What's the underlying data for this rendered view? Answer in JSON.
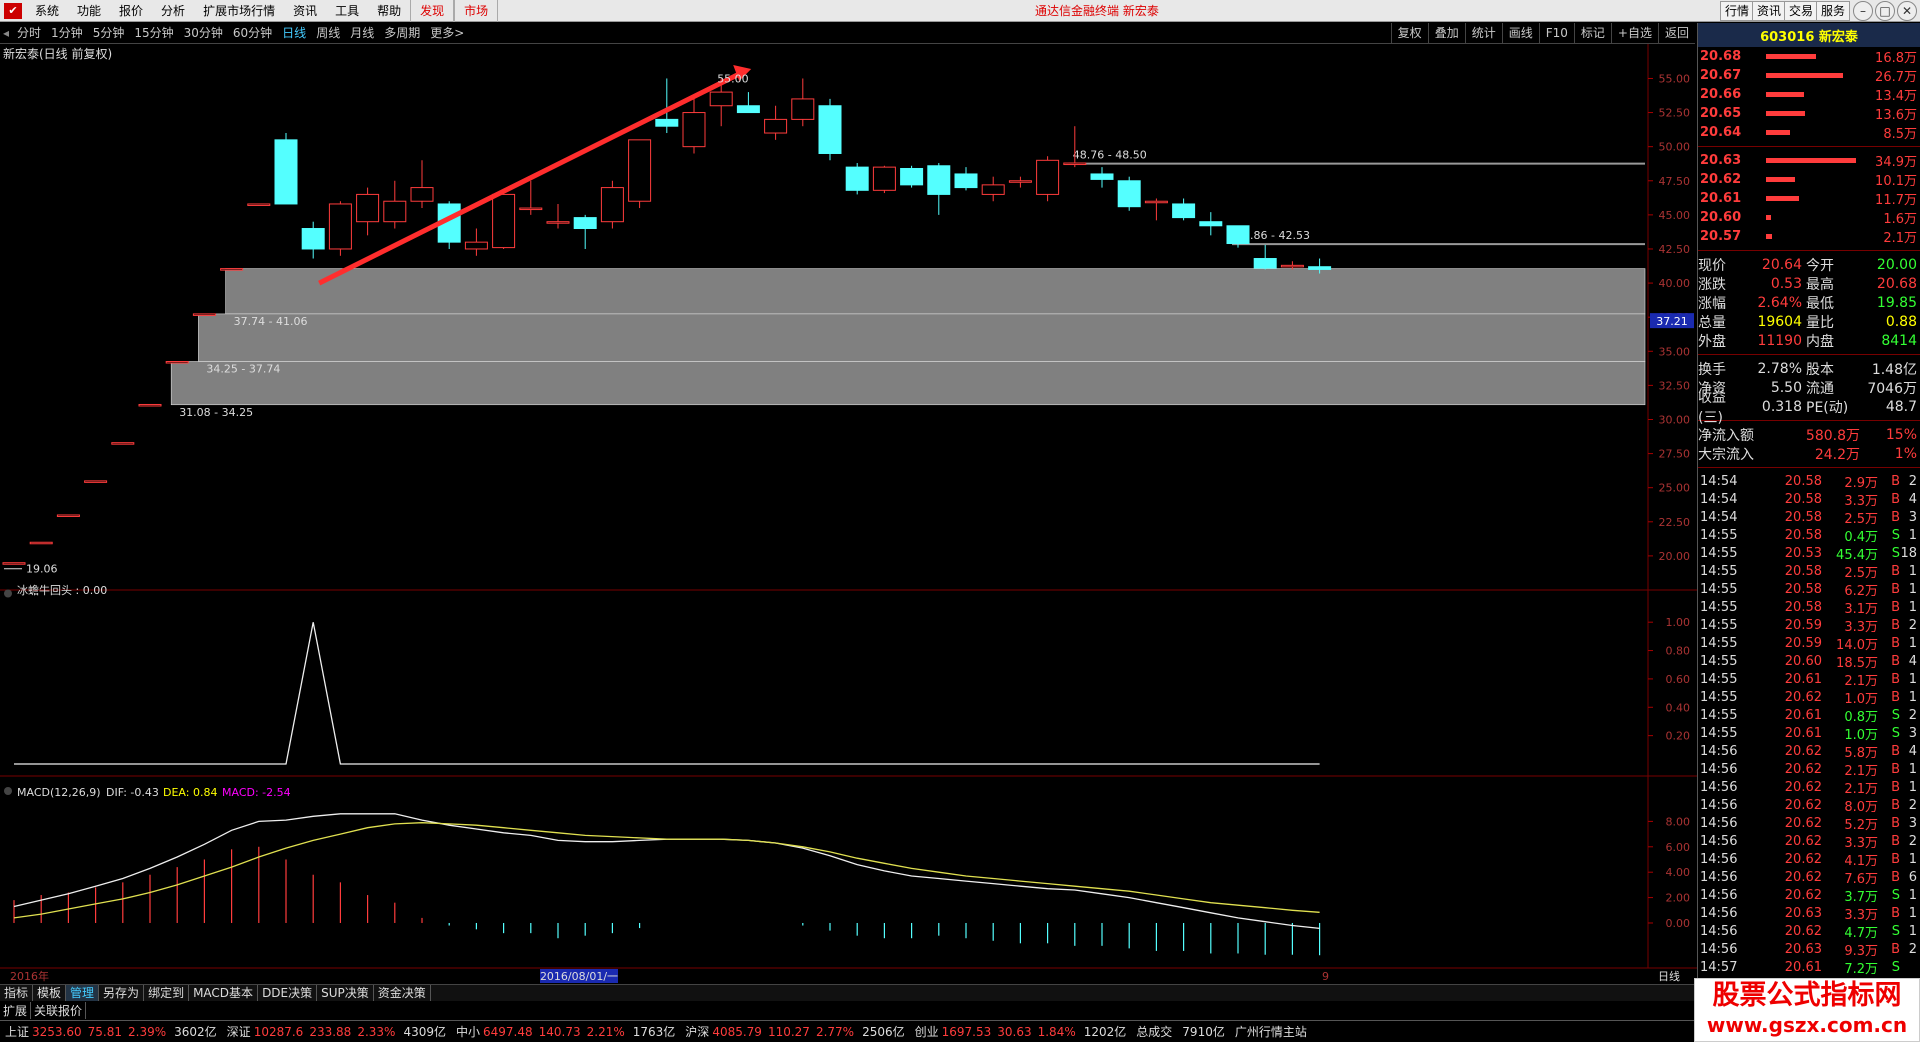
{
  "menubar": {
    "items": [
      "系统",
      "功能",
      "报价",
      "分析",
      "扩展市场行情",
      "资讯",
      "工具",
      "帮助"
    ],
    "highlight_items": [
      "发现",
      "市场"
    ],
    "title": "通达信金融终端  新宏泰",
    "right_buttons": [
      "行情",
      "资讯",
      "交易",
      "服务"
    ]
  },
  "periodbar": {
    "items": [
      "分时",
      "1分钟",
      "5分钟",
      "15分钟",
      "30分钟",
      "60分钟",
      "日线",
      "周线",
      "月线",
      "多周期",
      "更多>"
    ],
    "active": "日线",
    "tools": [
      "复权",
      "叠加",
      "统计",
      "画线",
      "F10",
      "标记",
      "+自选",
      "返回"
    ]
  },
  "main_chart": {
    "title": "新宏泰(日线 前复权)",
    "y_ticks": [
      "55.00",
      "52.50",
      "50.00",
      "47.50",
      "45.00",
      "42.50",
      "40.00",
      "37.50",
      "35.00",
      "32.50",
      "30.00",
      "27.50",
      "25.00",
      "22.50",
      "20.00"
    ],
    "current_price_tag": "37.21",
    "peak_label": "55.00",
    "low_label": "19.06",
    "zone_labels": [
      "48.76 - 48.50",
      "42.86 - 42.53",
      "37.74 - 41.06",
      "34.25 - 37.74",
      "31.08 - 34.25"
    ]
  },
  "chart_data": [
    {
      "type": "candlestick",
      "title": "新宏泰(日线 前复权)",
      "ylim": [
        17.5,
        56.5
      ],
      "y_ticks": [
        20,
        22.5,
        25,
        27.5,
        30,
        32.5,
        35,
        37.5,
        40,
        42.5,
        45,
        47.5,
        50,
        52.5,
        55
      ],
      "ohlc": [
        [
          19.5,
          19.5,
          19.5,
          19.5
        ],
        [
          21.0,
          21.0,
          21.0,
          21.0
        ],
        [
          23.0,
          23.0,
          23.0,
          23.0
        ],
        [
          25.5,
          25.5,
          25.5,
          25.5
        ],
        [
          28.3,
          28.3,
          28.3,
          28.3
        ],
        [
          31.1,
          31.1,
          31.1,
          31.1
        ],
        [
          34.25,
          34.25,
          34.25,
          34.25
        ],
        [
          37.74,
          37.74,
          37.74,
          37.74
        ],
        [
          41.06,
          41.06,
          41.06,
          41.06
        ],
        [
          45.8,
          45.8,
          45.8,
          45.8
        ],
        [
          50.5,
          51.0,
          45.8,
          45.8
        ],
        [
          44.0,
          44.5,
          41.8,
          42.5
        ],
        [
          42.5,
          46.0,
          42.0,
          45.8
        ],
        [
          44.5,
          47.0,
          43.5,
          46.5
        ],
        [
          44.5,
          47.5,
          44.0,
          46.0
        ],
        [
          46.0,
          49.0,
          45.5,
          47.0
        ],
        [
          45.8,
          46.0,
          42.5,
          43.0
        ],
        [
          42.5,
          44.0,
          42.0,
          43.0
        ],
        [
          42.6,
          46.8,
          42.5,
          46.5
        ],
        [
          45.5,
          47.5,
          45.0,
          45.5
        ],
        [
          44.5,
          45.8,
          44.0,
          44.5
        ],
        [
          44.8,
          45.0,
          42.5,
          44.0
        ],
        [
          44.5,
          47.5,
          44.0,
          47.0
        ],
        [
          46.0,
          50.5,
          45.5,
          50.5
        ],
        [
          52.0,
          55.0,
          51.0,
          51.5
        ],
        [
          50.0,
          53.5,
          49.5,
          52.5
        ],
        [
          53.0,
          55.0,
          51.5,
          54.0
        ],
        [
          53.0,
          54.0,
          52.5,
          52.5
        ],
        [
          51.0,
          53.0,
          50.5,
          52.0
        ],
        [
          52.0,
          55.0,
          51.5,
          53.5
        ],
        [
          53.0,
          53.5,
          49.0,
          49.5
        ],
        [
          48.5,
          48.8,
          46.5,
          46.8
        ],
        [
          46.8,
          48.6,
          46.6,
          48.5
        ],
        [
          48.4,
          48.6,
          47.0,
          47.2
        ],
        [
          48.6,
          48.8,
          45.0,
          46.5
        ],
        [
          48.0,
          48.5,
          46.8,
          47.0
        ],
        [
          46.5,
          47.8,
          46.0,
          47.2
        ],
        [
          47.4,
          47.8,
          47.0,
          47.5
        ],
        [
          46.5,
          49.3,
          46.0,
          49.0
        ],
        [
          48.7,
          51.5,
          48.5,
          48.8
        ],
        [
          48.0,
          48.5,
          47.0,
          47.6
        ],
        [
          47.5,
          47.8,
          45.3,
          45.6
        ],
        [
          46.0,
          46.2,
          44.6,
          46.0
        ],
        [
          45.8,
          46.2,
          44.6,
          44.8
        ],
        [
          44.5,
          45.2,
          43.5,
          44.2
        ],
        [
          44.2,
          44.2,
          42.6,
          42.9
        ],
        [
          41.8,
          42.8,
          41.0,
          41.1
        ],
        [
          41.2,
          41.6,
          41.0,
          41.3
        ],
        [
          41.2,
          41.8,
          40.7,
          41.0
        ]
      ],
      "zones": [
        {
          "label": "48.76 - 48.50",
          "low": 48.5,
          "high": 48.76
        },
        {
          "label": "42.86 - 42.53",
          "low": 42.53,
          "high": 42.86
        },
        {
          "label": "37.74 - 41.06",
          "low": 37.74,
          "high": 41.06
        },
        {
          "label": "34.25 - 37.74",
          "low": 34.25,
          "high": 37.74
        },
        {
          "label": "31.08 - 34.25",
          "low": 31.08,
          "high": 34.25
        }
      ]
    },
    {
      "type": "line",
      "title": "冰蟾牛回头 : 0.00",
      "ylim": [
        0,
        1.1
      ],
      "y_ticks": [
        0.2,
        0.4,
        0.6,
        0.8,
        1.0
      ],
      "series": [
        {
          "name": "冰蟾牛回头",
          "values": [
            0,
            0,
            0,
            0,
            0,
            0,
            0,
            0,
            0,
            0,
            0,
            1,
            0,
            0,
            0,
            0,
            0,
            0,
            0,
            0,
            0,
            0,
            0,
            0,
            0,
            0,
            0,
            0,
            0,
            0,
            0,
            0,
            0,
            0,
            0,
            0,
            0,
            0,
            0,
            0,
            0,
            0,
            0,
            0,
            0,
            0,
            0,
            0,
            0
          ]
        }
      ]
    },
    {
      "type": "line",
      "title": "MACD(12,26,9)",
      "ylim": [
        -2.6,
        10
      ],
      "y_ticks": [
        0,
        2,
        4,
        6,
        8
      ],
      "series": [
        {
          "name": "DIF",
          "values": [
            1.3,
            1.8,
            2.3,
            2.9,
            3.5,
            4.3,
            5.2,
            6.2,
            7.3,
            8.0,
            8.1,
            8.4,
            8.6,
            8.6,
            8.6,
            8.1,
            7.7,
            7.4,
            7.1,
            6.9,
            6.5,
            6.4,
            6.4,
            6.5,
            6.6,
            6.6,
            6.6,
            6.5,
            6.3,
            5.9,
            5.3,
            4.6,
            4.1,
            3.7,
            3.5,
            3.3,
            3.1,
            2.9,
            2.7,
            2.6,
            2.3,
            2.0,
            1.6,
            1.2,
            0.8,
            0.4,
            0.1,
            -0.2,
            -0.43
          ]
        },
        {
          "name": "DEA",
          "values": [
            0.4,
            0.7,
            1.1,
            1.5,
            1.9,
            2.4,
            3.0,
            3.7,
            4.4,
            5.2,
            5.9,
            6.5,
            7.0,
            7.5,
            7.8,
            7.9,
            7.8,
            7.7,
            7.5,
            7.3,
            7.1,
            6.9,
            6.8,
            6.7,
            6.6,
            6.6,
            6.6,
            6.5,
            6.3,
            6.0,
            5.6,
            5.1,
            4.7,
            4.3,
            4.0,
            3.7,
            3.5,
            3.3,
            3.1,
            2.9,
            2.7,
            2.5,
            2.2,
            1.9,
            1.6,
            1.4,
            1.2,
            1.0,
            0.84
          ]
        },
        {
          "name": "MACD",
          "values": [
            1.8,
            2.2,
            2.4,
            2.8,
            3.2,
            3.8,
            4.4,
            5.0,
            5.8,
            6.0,
            5.0,
            3.8,
            3.2,
            2.2,
            1.6,
            0.4,
            -0.2,
            -0.5,
            -0.8,
            -0.8,
            -1.2,
            -1.0,
            -0.8,
            -0.4,
            0.0,
            0.0,
            0.0,
            0.0,
            0.0,
            -0.2,
            -0.6,
            -1.0,
            -1.2,
            -1.2,
            -1.0,
            -1.2,
            -1.4,
            -1.6,
            -1.6,
            -1.8,
            -1.8,
            -2.0,
            -2.2,
            -2.2,
            -2.4,
            -2.4,
            -2.5,
            -2.5,
            -2.54
          ]
        }
      ]
    }
  ],
  "indicator1": {
    "title": "冰蟾牛回头 : 0.00",
    "y_ticks": [
      "1.00",
      "0.80",
      "0.60",
      "0.40",
      "0.20"
    ]
  },
  "macd": {
    "label": "MACD(12,26,9)",
    "dif": "DIF: -0.43",
    "dea": "DEA: 0.84",
    "macd": "MACD: -2.54",
    "y_ticks": [
      "8.00",
      "6.00",
      "4.00",
      "2.00",
      "0.00"
    ]
  },
  "xaxis": {
    "year": "2016年",
    "date_cursor": "2016/08/01/一",
    "month_mark": "9",
    "period": "日线"
  },
  "rightpanel": {
    "stock": "603016 新宏泰",
    "orderbook": [
      {
        "p": "20.68",
        "v": "16.8万",
        "f": 0.55
      },
      {
        "p": "20.67",
        "v": "26.7万",
        "f": 0.85
      },
      {
        "p": "20.66",
        "v": "13.4万",
        "f": 0.42
      },
      {
        "p": "20.65",
        "v": "13.6万",
        "f": 0.43
      },
      {
        "p": "20.64",
        "v": "8.5万",
        "f": 0.27
      },
      {
        "p": "20.63",
        "v": "34.9万",
        "f": 1.0
      },
      {
        "p": "20.62",
        "v": "10.1万",
        "f": 0.32
      },
      {
        "p": "20.61",
        "v": "11.7万",
        "f": 0.37
      },
      {
        "p": "20.60",
        "v": "1.6万",
        "f": 0.05
      },
      {
        "p": "20.57",
        "v": "2.1万",
        "f": 0.07
      }
    ],
    "quotes": [
      {
        "l": "现价",
        "n": "20.64",
        "nc": "red",
        "l2": "今开",
        "n2": "20.00",
        "n2c": "green"
      },
      {
        "l": "涨跌",
        "n": "0.53",
        "nc": "red",
        "l2": "最高",
        "n2": "20.68",
        "n2c": "red"
      },
      {
        "l": "涨幅",
        "n": "2.64%",
        "nc": "red",
        "l2": "最低",
        "n2": "19.85",
        "n2c": "green"
      },
      {
        "l": "总量",
        "n": "19604",
        "nc": "yel",
        "l2": "量比",
        "n2": "0.88",
        "n2c": "yel"
      },
      {
        "l": "外盘",
        "n": "11190",
        "nc": "red",
        "l2": "内盘",
        "n2": "8414",
        "n2c": "green"
      }
    ],
    "quotes2": [
      {
        "l": "换手",
        "n": "2.78%",
        "l2": "股本",
        "n2": "1.48亿"
      },
      {
        "l": "净资",
        "n": "5.50",
        "l2": "流通",
        "n2": "7046万"
      },
      {
        "l": "收益(三)",
        "n": "0.318",
        "l2": "PE(动)",
        "n2": "48.7"
      }
    ],
    "flows": [
      {
        "l": "净流入额",
        "n": "580.8万",
        "p": "15%"
      },
      {
        "l": "大宗流入",
        "n": "24.2万",
        "p": "1%"
      }
    ],
    "ticks": [
      {
        "t": "14:54",
        "p": "20.58",
        "v": "2.9万",
        "d": "B",
        "c": "2"
      },
      {
        "t": "14:54",
        "p": "20.58",
        "v": "3.3万",
        "d": "B",
        "c": "4"
      },
      {
        "t": "14:54",
        "p": "20.58",
        "v": "2.5万",
        "d": "B",
        "c": "3"
      },
      {
        "t": "14:55",
        "p": "20.58",
        "v": "0.4万",
        "d": "S",
        "c": "1"
      },
      {
        "t": "14:55",
        "p": "20.53",
        "v": "45.4万",
        "d": "S",
        "c": "18"
      },
      {
        "t": "14:55",
        "p": "20.58",
        "v": "2.5万",
        "d": "B",
        "c": "1"
      },
      {
        "t": "14:55",
        "p": "20.58",
        "v": "6.2万",
        "d": "B",
        "c": "1"
      },
      {
        "t": "14:55",
        "p": "20.58",
        "v": "3.1万",
        "d": "B",
        "c": "1"
      },
      {
        "t": "14:55",
        "p": "20.59",
        "v": "3.3万",
        "d": "B",
        "c": "2"
      },
      {
        "t": "14:55",
        "p": "20.59",
        "v": "14.0万",
        "d": "B",
        "c": "1"
      },
      {
        "t": "14:55",
        "p": "20.60",
        "v": "18.5万",
        "d": "B",
        "c": "4"
      },
      {
        "t": "14:55",
        "p": "20.61",
        "v": "2.1万",
        "d": "B",
        "c": "1"
      },
      {
        "t": "14:55",
        "p": "20.62",
        "v": "1.0万",
        "d": "B",
        "c": "1"
      },
      {
        "t": "14:55",
        "p": "20.61",
        "v": "0.8万",
        "d": "S",
        "c": "2"
      },
      {
        "t": "14:55",
        "p": "20.61",
        "v": "1.0万",
        "d": "S",
        "c": "3"
      },
      {
        "t": "14:56",
        "p": "20.62",
        "v": "5.8万",
        "d": "B",
        "c": "4"
      },
      {
        "t": "14:56",
        "p": "20.62",
        "v": "2.1万",
        "d": "B",
        "c": "1"
      },
      {
        "t": "14:56",
        "p": "20.62",
        "v": "2.1万",
        "d": "B",
        "c": "1"
      },
      {
        "t": "14:56",
        "p": "20.62",
        "v": "8.0万",
        "d": "B",
        "c": "2"
      },
      {
        "t": "14:56",
        "p": "20.62",
        "v": "5.2万",
        "d": "B",
        "c": "3"
      },
      {
        "t": "14:56",
        "p": "20.62",
        "v": "3.3万",
        "d": "B",
        "c": "2"
      },
      {
        "t": "14:56",
        "p": "20.62",
        "v": "4.1万",
        "d": "B",
        "c": "1"
      },
      {
        "t": "14:56",
        "p": "20.62",
        "v": "7.6万",
        "d": "B",
        "c": "6"
      },
      {
        "t": "14:56",
        "p": "20.62",
        "v": "3.7万",
        "d": "S",
        "c": "1"
      },
      {
        "t": "14:56",
        "p": "20.63",
        "v": "3.3万",
        "d": "B",
        "c": "1"
      },
      {
        "t": "14:56",
        "p": "20.62",
        "v": "4.7万",
        "d": "S",
        "c": "1"
      },
      {
        "t": "14:56",
        "p": "20.63",
        "v": "9.3万",
        "d": "B",
        "c": "2"
      },
      {
        "t": "14:57",
        "p": "20.61",
        "v": "7.2万",
        "d": "S",
        "c": ""
      }
    ]
  },
  "bottomtabs": [
    "指标",
    "模板",
    "管理",
    "另存为",
    "绑定到",
    "MACD基本",
    "DDE决策",
    "SUP决策",
    "资金决策"
  ],
  "bottomtabs_active": "管理",
  "extbar": [
    "扩展",
    "关联报价"
  ],
  "statusbar": [
    {
      "name": "上证",
      "v1": "3253.60",
      "v2": "75.81",
      "v3": "2.39%",
      "v4": "3602亿"
    },
    {
      "name": "深证",
      "v1": "10287.6",
      "v2": "233.88",
      "v3": "2.33%",
      "v4": "4309亿"
    },
    {
      "name": "中小",
      "v1": "6497.48",
      "v2": "140.73",
      "v3": "2.21%",
      "v4": "1763亿"
    },
    {
      "name": "沪深",
      "v1": "4085.79",
      "v2": "110.27",
      "v3": "2.77%",
      "v4": "2506亿"
    },
    {
      "name": "创业",
      "v1": "1697.53",
      "v2": "30.63",
      "v3": "1.84%",
      "v4": "1202亿"
    }
  ],
  "status_total": {
    "label": "总成交",
    "v": "7910亿"
  },
  "status_server": "广州行情主站",
  "watermark": {
    "line1": "股票公式指标网",
    "line2": "www.gszx.com.cn"
  }
}
